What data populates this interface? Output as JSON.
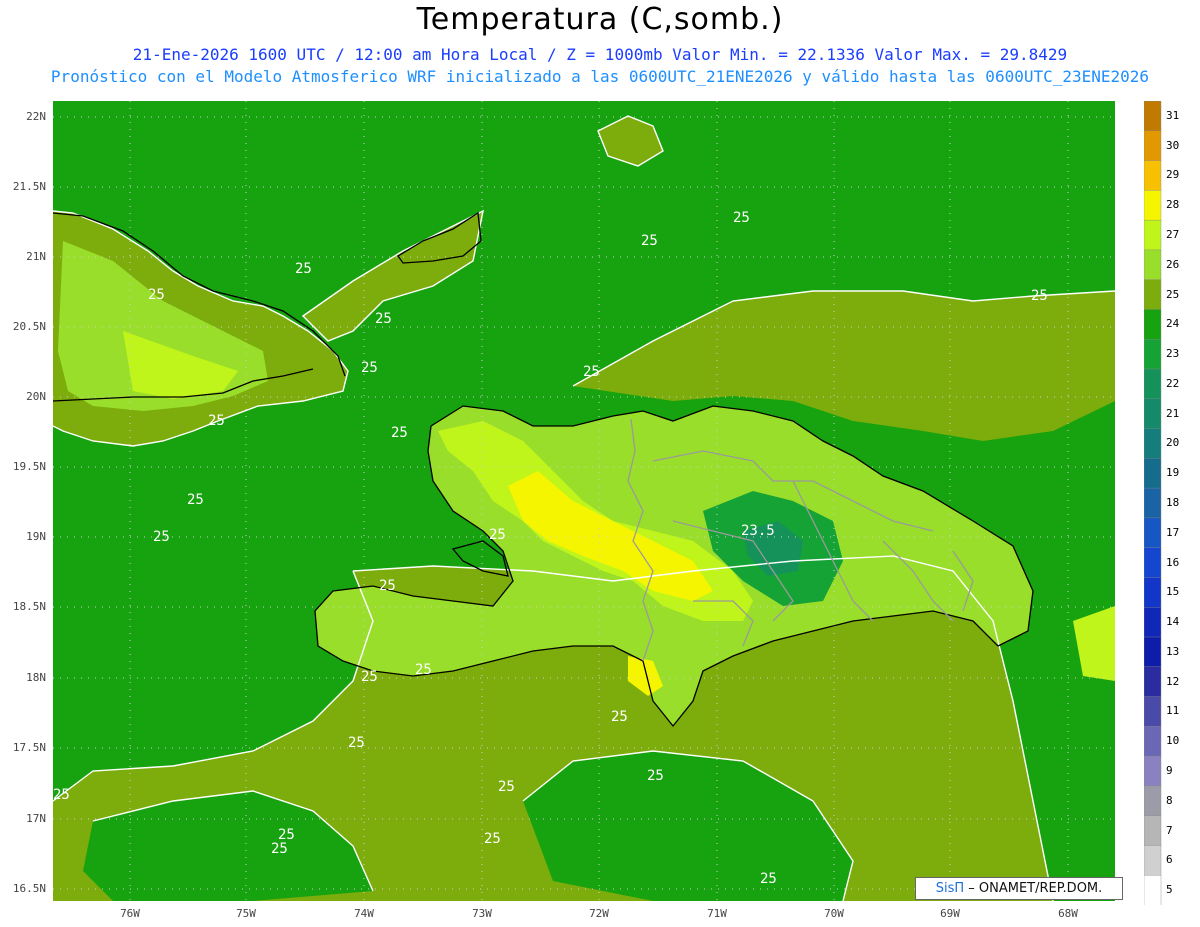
{
  "header": {
    "title": "Temperatura (C,somb.)",
    "subtitle_line1": "21-Ene-2026 1600 UTC / 12:00 am Hora Local / Z = 1000mb   Valor Min. = 22.1336   Valor Max. = 29.8429",
    "subtitle_line2": "Pronóstico con el Modelo Atmosferico WRF inicializado a las 0600UTC_21ENE2026 y válido hasta las  0600UTC_23ENE2026"
  },
  "axes": {
    "y_ticks": [
      "22N",
      "21.5N",
      "21N",
      "20.5N",
      "20N",
      "19.5N",
      "19N",
      "18.5N",
      "18N",
      "17.5N",
      "17N",
      "16.5N"
    ],
    "x_ticks": [
      "76W",
      "75W",
      "74W",
      "73W",
      "72W",
      "71W",
      "70W",
      "69W",
      "68W"
    ]
  },
  "contour_labels": [
    "25",
    "25",
    "25",
    "25",
    "25",
    "25",
    "25",
    "25",
    "25",
    "25",
    "25",
    "25",
    "25",
    "25",
    "25",
    "25",
    "25",
    "25",
    "25",
    "25",
    "25",
    "25",
    "25",
    "25",
    "25",
    "23.5"
  ],
  "legend": {
    "labels": [
      "31",
      "30",
      "29",
      "28",
      "27",
      "26",
      "25",
      "24",
      "23",
      "22",
      "21",
      "20",
      "19",
      "18",
      "17",
      "16",
      "15",
      "14",
      "13",
      "12",
      "11",
      "10",
      "9",
      "8",
      "7",
      "6",
      "5"
    ],
    "colors": [
      "#c07a00",
      "#e29800",
      "#f7c000",
      "#f5f500",
      "#bff51a",
      "#99de2a",
      "#7dad0c",
      "#17a20f",
      "#16a336",
      "#14925a",
      "#148a6a",
      "#157d7c",
      "#156c8c",
      "#1a63a5",
      "#1657c3",
      "#1446d0",
      "#1236c8",
      "#0f28b8",
      "#0e1caa",
      "#2a2ca0",
      "#4a4aa8",
      "#6a68b4",
      "#8a82c0",
      "#9c9ca8",
      "#b6b6b6",
      "#d0d0d0",
      "#ffffff"
    ]
  },
  "credit": {
    "logo": "SisΠ",
    "text": " – ONAMET/REP.DOM."
  },
  "colors": {
    "ocean": "#17a20f",
    "warm_land": "#7dad0c",
    "hot": "#bff51a",
    "hotter": "#f5f500",
    "cool_highlands": "#16a336",
    "coast": "#000000",
    "borders": "#9a9a9a",
    "contours": "#ffffff"
  }
}
